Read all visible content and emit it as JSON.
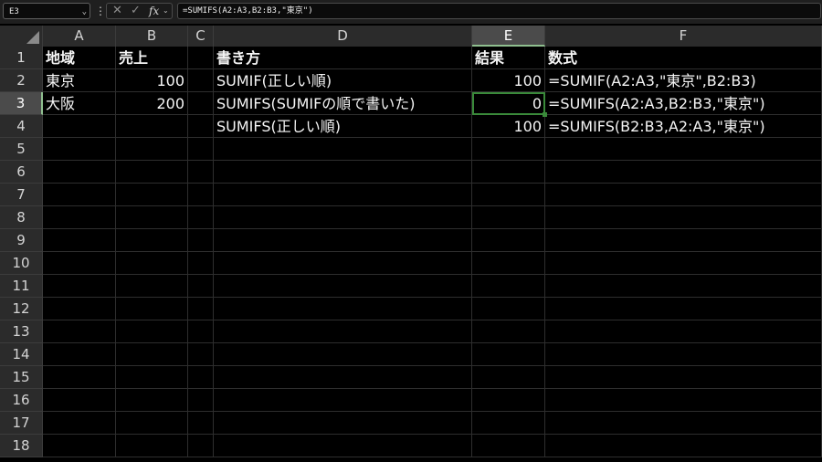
{
  "formula_bar": {
    "name_box": "E3",
    "formula": "=SUMIFS(A2:A3,B2:B3,\"東京\")",
    "fx": "fx"
  },
  "columns": [
    "A",
    "B",
    "C",
    "D",
    "E",
    "F"
  ],
  "selected_column": "E",
  "selected_row": 3,
  "rows": [
    1,
    2,
    3,
    4,
    5,
    6,
    7,
    8,
    9,
    10,
    11,
    12,
    13,
    14,
    15,
    16,
    17,
    18
  ],
  "cells": {
    "A1": "地域",
    "B1": "売上",
    "D1": "書き方",
    "E1": "結果",
    "F1": "数式",
    "A2": "東京",
    "B2": "100",
    "D2": "SUMIF(正しい順)",
    "E2": "100",
    "F2": "=SUMIF(A2:A3,\"東京\",B2:B3)",
    "A3": "大阪",
    "B3": "200",
    "D3": "SUMIFS(SUMIFの順で書いた)",
    "E3": "0",
    "F3": "=SUMIFS(A2:A3,B2:B3,\"東京\")",
    "D4": "SUMIFS(正しい順)",
    "E4": "100",
    "F4": "=SUMIFS(B2:B3,A2:A3,\"東京\")"
  },
  "colors": {
    "background": "#000000",
    "header_bg": "#2b2b2b",
    "selection": "#3a8a3a"
  }
}
